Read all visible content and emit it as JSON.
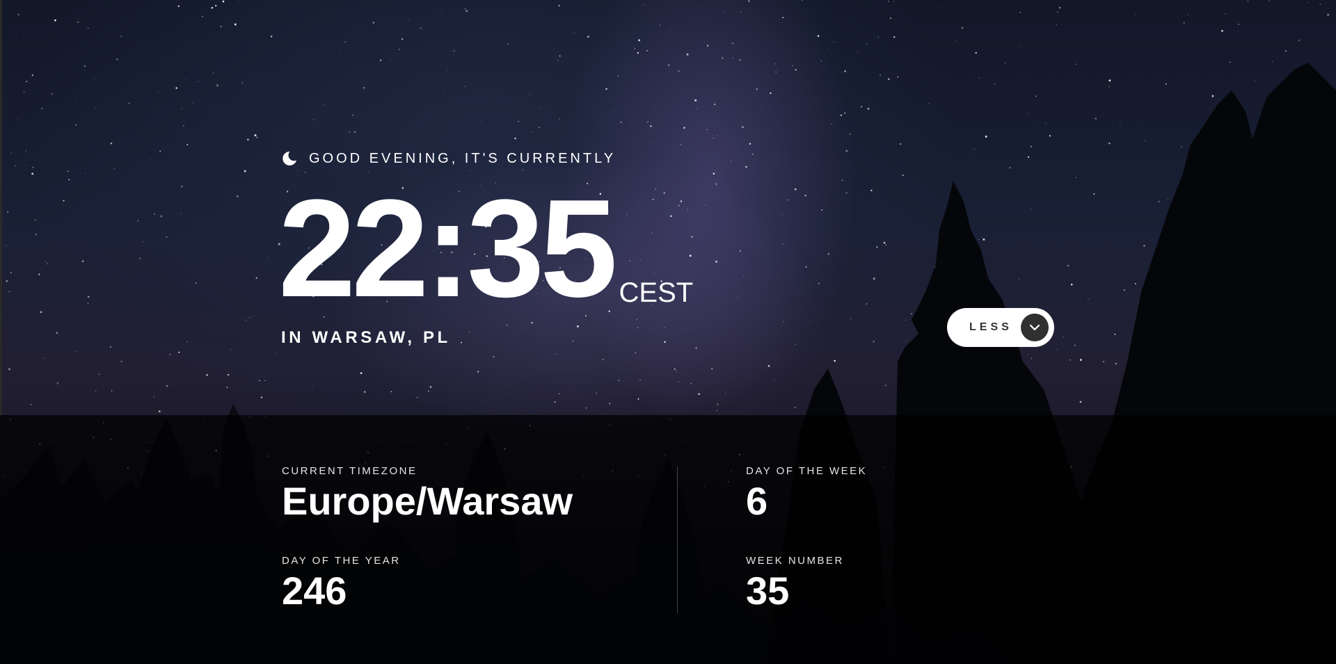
{
  "greeting": {
    "icon": "moon-icon",
    "text": "GOOD EVENING, IT'S CURRENTLY"
  },
  "clock": {
    "time": "22:35",
    "abbreviation": "CEST",
    "location": "IN WARSAW, PL"
  },
  "toggle": {
    "label": "LESS",
    "icon": "chevron-down-icon"
  },
  "details": {
    "timezone": {
      "label": "CURRENT TIMEZONE",
      "value": "Europe/Warsaw"
    },
    "day_of_year": {
      "label": "DAY OF THE YEAR",
      "value": "246"
    },
    "day_of_week": {
      "label": "DAY OF THE WEEK",
      "value": "6"
    },
    "week_number": {
      "label": "WEEK NUMBER",
      "value": "35"
    }
  },
  "colors": {
    "text": "#ffffff",
    "button_bg": "#ffffff",
    "button_icon_bg": "#303030",
    "panel_bg": "#000000"
  }
}
